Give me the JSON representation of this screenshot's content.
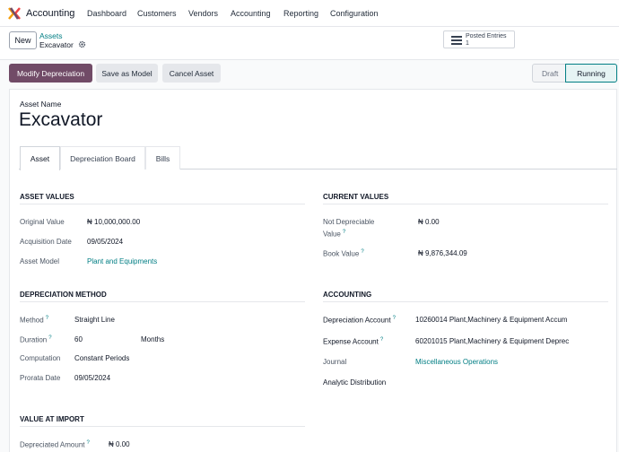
{
  "app": {
    "name": "Accounting",
    "logo_icon": "odoo-accounting-icon"
  },
  "menu": [
    "Dashboard",
    "Customers",
    "Vendors",
    "Accounting",
    "Reporting",
    "Configuration"
  ],
  "control": {
    "new_label": "New",
    "breadcrumb_parent": "Assets",
    "breadcrumb_current": "Excavator",
    "smart_button": {
      "label": "Posted Entries",
      "count": "1"
    }
  },
  "actions": {
    "modify": "Modify Depreciation",
    "save_model": "Save as Model",
    "cancel": "Cancel Asset"
  },
  "status": {
    "draft": "Draft",
    "running": "Running",
    "active": "Running"
  },
  "form": {
    "asset_name_label": "Asset Name",
    "asset_name": "Excavator",
    "tabs": [
      "Asset",
      "Depreciation Board",
      "Bills"
    ],
    "active_tab": "Asset",
    "asset_values": {
      "title": "ASSET VALUES",
      "original_value_label": "Original Value",
      "original_value": "₦ 10,000,000.00",
      "acquisition_date_label": "Acquisition Date",
      "acquisition_date": "09/05/2024",
      "asset_model_label": "Asset Model",
      "asset_model": "Plant and Equipments"
    },
    "current_values": {
      "title": "CURRENT VALUES",
      "not_depreciable_label_1": "Not Depreciable",
      "not_depreciable_label_2": "Value",
      "not_depreciable": "₦ 0.00",
      "book_value_label": "Book Value",
      "book_value": "₦ 9,876,344.09"
    },
    "depreciation_method": {
      "title": "DEPRECIATION METHOD",
      "method_label": "Method",
      "method": "Straight Line",
      "duration_label": "Duration",
      "duration": "60",
      "duration_unit": "Months",
      "computation_label": "Computation",
      "computation": "Constant Periods",
      "prorata_label": "Prorata Date",
      "prorata": "09/05/2024"
    },
    "accounting": {
      "title": "ACCOUNTING",
      "depreciation_account_label": "Depreciation Account",
      "depreciation_account": "10260014 Plant,Machinery & Equipment Accum",
      "expense_account_label": "Expense Account",
      "expense_account": "60201015 Plant,Machinery & Equipment Deprec",
      "journal_label": "Journal",
      "journal": "Miscellaneous Operations",
      "analytic_label": "Analytic Distribution"
    },
    "value_at_import": {
      "title": "VALUE AT IMPORT",
      "depreciated_amount_label": "Depreciated Amount",
      "depreciated_amount": "₦ 0.00"
    },
    "help_mark": "?"
  },
  "colors": {
    "primary": "#714b67",
    "link": "#017e84"
  }
}
